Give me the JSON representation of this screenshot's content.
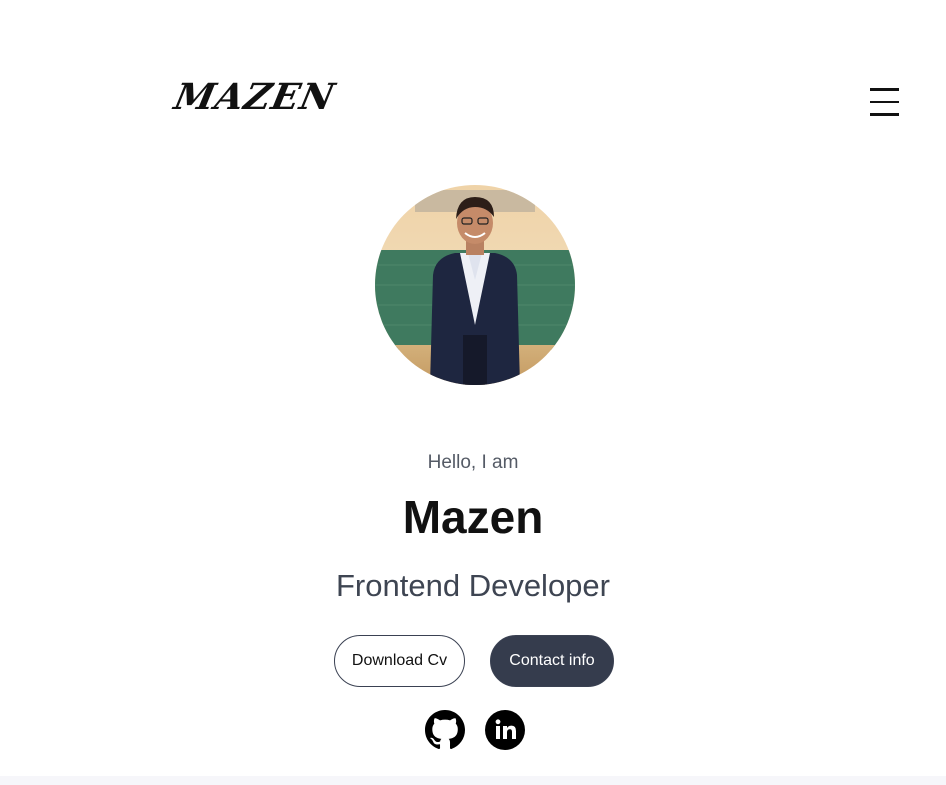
{
  "header": {
    "logo_text": "MAZEN",
    "menu_icon": "hamburger-icon"
  },
  "hero": {
    "greeting": "Hello, I am",
    "name": "Mazen",
    "role": "Frontend Developer",
    "download_label": "Download Cv",
    "contact_label": "Contact info"
  },
  "social": {
    "icons": [
      "github-icon",
      "linkedin-icon"
    ]
  },
  "colors": {
    "text_dark": "#111111",
    "text_muted": "#555b66",
    "role_text": "#3e4552",
    "contact_bg": "#353c4d",
    "button_border": "#3a4152"
  }
}
